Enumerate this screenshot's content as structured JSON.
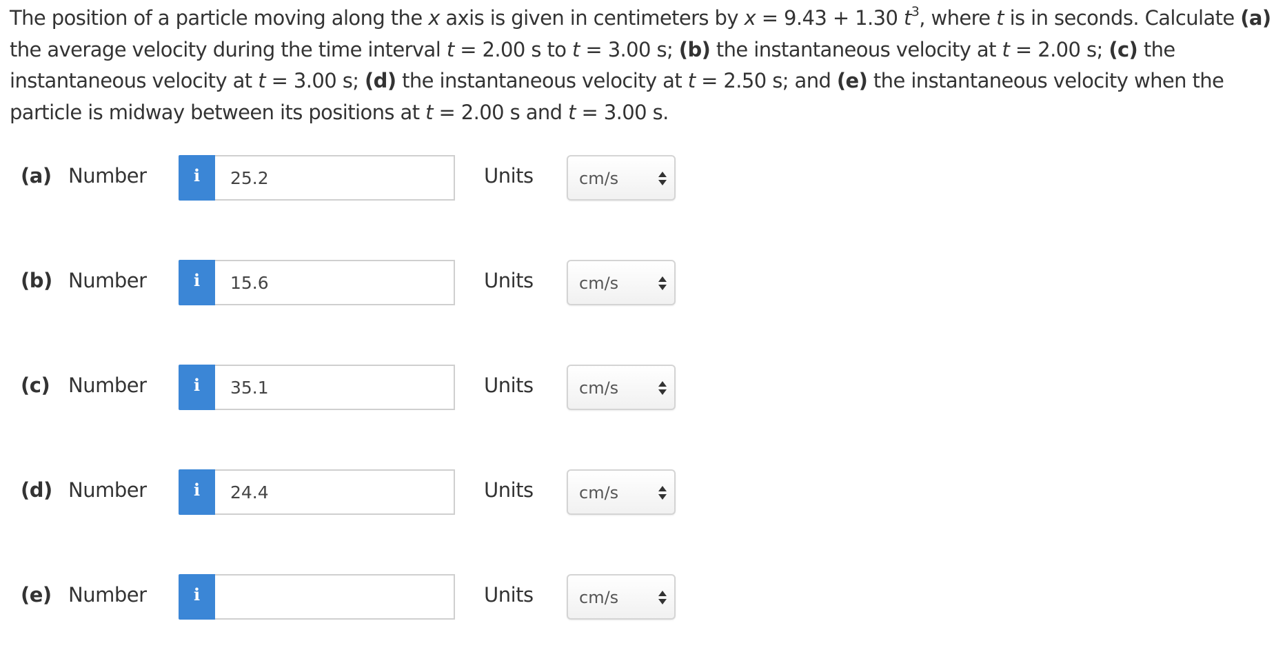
{
  "question": {
    "s1": "The position of a particle moving along the ",
    "x1": "x",
    "s2": " axis is given in centimeters by ",
    "x2": "x",
    "s3": " = 9.43 + 1.30 ",
    "t1": "t",
    "exp": "3",
    "s4": ", where ",
    "t2": "t",
    "s5": " is in seconds. Calculate ",
    "a": "(a)",
    "s6": " the average velocity during the time interval ",
    "t3": "t",
    "s7": " = 2.00 s to ",
    "t4": "t",
    "s8": " = 3.00 s; ",
    "b": "(b)",
    "s9": " the instantaneous velocity at ",
    "t5": "t",
    "s10": " = 2.00 s; ",
    "c": "(c)",
    "s11": " the instantaneous velocity at ",
    "t6": "t",
    "s12": " = 3.00 s; ",
    "d": "(d)",
    "s13": " the instantaneous velocity at ",
    "t7": "t",
    "s14": " = 2.50 s; and ",
    "e": "(e)",
    "s15": " the instantaneous velocity when the particle is midway between its positions at ",
    "t8": "t",
    "s16": " = 2.00 s and ",
    "t9": "t",
    "s17": " = 3.00 s."
  },
  "answers": [
    {
      "part": "(a)",
      "number_label": "Number",
      "info": "i",
      "value": "25.2",
      "units_label": "Units",
      "units": "cm/s"
    },
    {
      "part": "(b)",
      "number_label": "Number",
      "info": "i",
      "value": "15.6",
      "units_label": "Units",
      "units": "cm/s"
    },
    {
      "part": "(c)",
      "number_label": "Number",
      "info": "i",
      "value": "35.1",
      "units_label": "Units",
      "units": "cm/s"
    },
    {
      "part": "(d)",
      "number_label": "Number",
      "info": "i",
      "value": "24.4",
      "units_label": "Units",
      "units": "cm/s"
    },
    {
      "part": "(e)",
      "number_label": "Number",
      "info": "i",
      "value": "",
      "units_label": "Units",
      "units": "cm/s"
    }
  ],
  "colors": {
    "info_button": "#3b86d6",
    "text": "#333333",
    "input_border": "#cfcfcf"
  }
}
